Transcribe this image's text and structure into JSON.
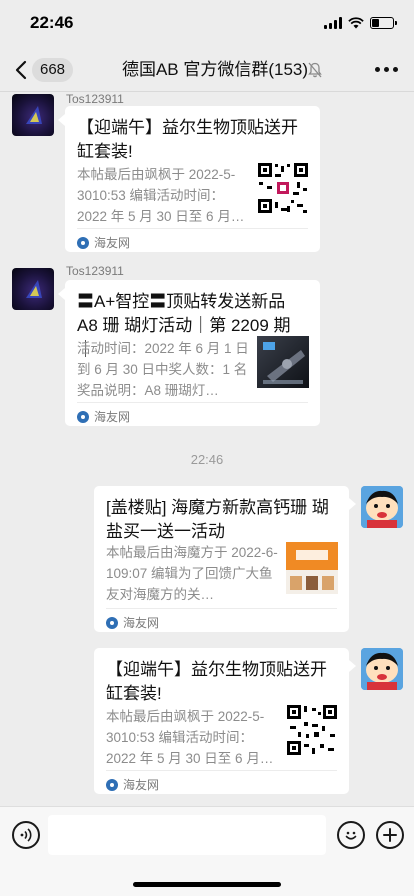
{
  "status_bar": {
    "time": "22:46"
  },
  "nav": {
    "back_count": "668",
    "title": "德国AB  官方微信群(153)"
  },
  "messages": [
    {
      "sender": "Tos123911",
      "title": "【迎端午】益尔生物顶贴送开缸套装!",
      "desc": "本帖最后由飒枫于 2022-5-3010:53 编辑活动时间：2022 年 5 月 30 日至 6 月…",
      "source": "海友网",
      "thumb": "qr-code"
    },
    {
      "sender": "Tos123911",
      "title": "〓A+智控〓顶贴转发送新品 A8 珊 瑚灯活动｜第 2209 期｜",
      "desc": "活动时间：2022 年 6 月 1 日到 6 月 30 日中奖人数：1 名奖品说明：A8 珊瑚灯…",
      "source": "海友网",
      "thumb": "product-photo"
    },
    {
      "time": "22:46"
    },
    {
      "sender": "self",
      "title": "[盖楼贴] 海魔方新款高钙珊 瑚盐买一送一活动",
      "desc": "本帖最后由海魔方于 2022-6-109:07 编辑为了回馈广大鱼友对海魔方的关…",
      "source": "海友网",
      "thumb": "salt-promo"
    },
    {
      "sender": "self",
      "title": "【迎端午】益尔生物顶贴送开缸套装!",
      "desc": "本帖最后由飒枫于 2022-5-3010:53 编辑活动时间：2022 年 5 月 30 日至 6 月…",
      "source": "海友网",
      "thumb": "qr-code"
    }
  ],
  "colors": {
    "background": "#ededed",
    "bubble": "#ffffff",
    "accent_blue": "#2f6fb5"
  },
  "icons": {
    "back": "chevron-left-icon",
    "mute": "bell-off-icon",
    "more": "more-dots-icon",
    "voice": "voice-icon",
    "emoji": "emoji-icon",
    "plus": "plus-icon"
  }
}
